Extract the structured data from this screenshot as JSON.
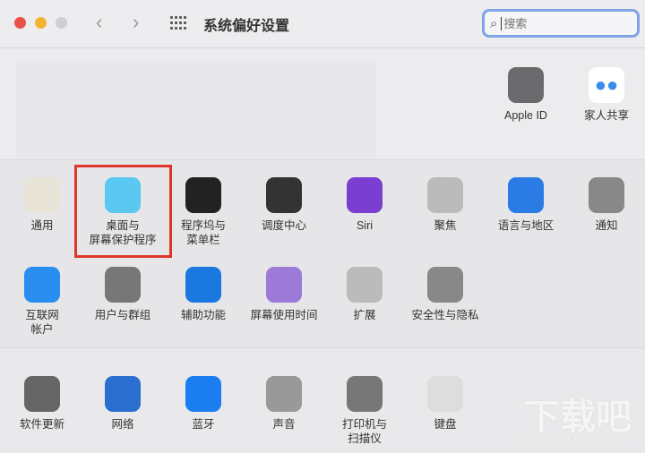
{
  "window": {
    "title": "系统偏好设置",
    "search_placeholder": "搜索"
  },
  "account": [
    {
      "label": "Apple ID",
      "icon": "apple-icon"
    },
    {
      "label": "家人共享",
      "icon": "family-icon"
    }
  ],
  "row1": [
    {
      "label": "通用",
      "icon": "general-icon",
      "color": "#e8e4d8"
    },
    {
      "label": "桌面与\n屏幕保护程序",
      "icon": "desktop-icon",
      "color": "#5ac8f0"
    },
    {
      "label": "程序坞与\n菜单栏",
      "icon": "dock-icon",
      "color": "#222"
    },
    {
      "label": "调度中心",
      "icon": "mission-control-icon",
      "color": "#333"
    },
    {
      "label": "Siri",
      "icon": "siri-icon",
      "color": "#7a3fd0"
    },
    {
      "label": "聚焦",
      "icon": "spotlight-icon",
      "color": "#bbb"
    },
    {
      "label": "语言与地区",
      "icon": "globe-flag-icon",
      "color": "#2a7be4"
    },
    {
      "label": "通知",
      "icon": "bell-icon",
      "color": "#888"
    }
  ],
  "row2": [
    {
      "label": "互联网\n帐户",
      "icon": "at-icon",
      "color": "#2a8ef0"
    },
    {
      "label": "用户与群组",
      "icon": "users-icon",
      "color": "#777"
    },
    {
      "label": "辅助功能",
      "icon": "accessibility-icon",
      "color": "#1a78e0"
    },
    {
      "label": "屏幕使用时间",
      "icon": "hourglass-icon",
      "color": "#9b7ad8"
    },
    {
      "label": "扩展",
      "icon": "puzzle-icon",
      "color": "#bbb"
    },
    {
      "label": "安全性与隐私",
      "icon": "house-lock-icon",
      "color": "#888"
    }
  ],
  "row3": [
    {
      "label": "软件更新",
      "icon": "gear-icon",
      "color": "#666"
    },
    {
      "label": "网络",
      "icon": "network-globe-icon",
      "color": "#2a6fd0"
    },
    {
      "label": "蓝牙",
      "icon": "bluetooth-icon",
      "color": "#1a7ef0"
    },
    {
      "label": "声音",
      "icon": "speaker-icon",
      "color": "#999"
    },
    {
      "label": "打印机与\n扫描仪",
      "icon": "printer-icon",
      "color": "#777"
    },
    {
      "label": "键盘",
      "icon": "keyboard-icon",
      "color": "#ddd"
    }
  ],
  "watermark": {
    "text": "下载吧",
    "url": "www.xiazaiba.com"
  }
}
